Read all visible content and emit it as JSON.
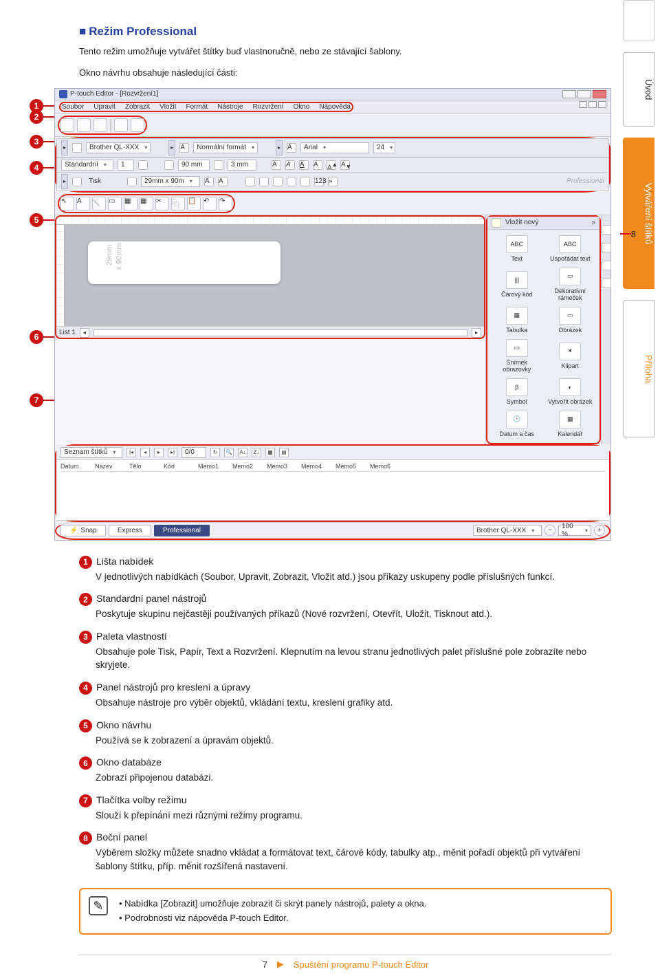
{
  "section": {
    "title": "Režim Professional",
    "lead1": "Tento režim umožňuje vytvářet štítky buď vlastnoručně, nebo ze stávající šablony.",
    "lead2": "Okno návrhu obsahuje následující části:"
  },
  "side_tabs": {
    "uvod": "Úvod",
    "stitky": "Vytváření štítků",
    "priloha": "Příloha"
  },
  "callouts": [
    "1",
    "2",
    "3",
    "4",
    "5",
    "6",
    "7",
    "8"
  ],
  "app": {
    "title": "P-touch Editor - [Rozvržení1]",
    "menu": [
      "Soubor",
      "Upravit",
      "Zobrazit",
      "Vložit",
      "Formát",
      "Nástroje",
      "Rozvržení",
      "Okno",
      "Nápověda"
    ],
    "printer": "Brother QL-XXX",
    "format_dd": "Normální formát",
    "font": "Arial",
    "font_size": "24",
    "std_label": "Standardní",
    "print_count": "1",
    "w": "90 mm",
    "h": "3 mm",
    "tisk": "Tisk",
    "tape": "29mm x 90m",
    "prof_brand": "Professional",
    "side_strip": "Vložit nový",
    "side_more": "»",
    "side_items": [
      [
        "Text",
        "ABC"
      ],
      [
        "Uspořádat text",
        "ABC"
      ],
      [
        "Čárový kód",
        "|||"
      ],
      [
        "Dekorativní rámeček",
        "▭"
      ],
      [
        "Tabulka",
        "▦"
      ],
      [
        "Obrázek",
        "▭"
      ],
      [
        "Snímek obrazovky",
        "▭"
      ],
      [
        "Klipart",
        "✶"
      ],
      [
        "Symbol",
        "β"
      ],
      [
        "Vytvořit obrázek",
        "◐"
      ],
      [
        "Datum a čas",
        "🕒"
      ],
      [
        "Kalendář",
        "▦"
      ]
    ],
    "canvas_dim1": "29mm",
    "canvas_dim2": "x 90mm",
    "list_label": "List 1",
    "db_label": "Seznam štítků",
    "db_nav_count": "0/0",
    "db_cols": [
      "Datum",
      "Název",
      "Tělo",
      "Kód",
      "Memo1",
      "Memo2",
      "Memo3",
      "Memo4",
      "Memo5",
      "Memo6"
    ],
    "mode_snap": "Snap",
    "mode_express": "Express",
    "mode_pro": "Professional",
    "status_printer": "Brother QL-XXX",
    "zoom": "100 %"
  },
  "legend": [
    {
      "n": "1",
      "h": "Lišta nabídek",
      "t": "V jednotlivých nabídkách (Soubor, Upravit, Zobrazit, Vložit atd.) jsou příkazy uskupeny podle příslušných funkcí."
    },
    {
      "n": "2",
      "h": "Standardní panel nástrojů",
      "t": "Poskytuje skupinu nejčastěji používaných příkazů (Nové rozvržení, Otevřít, Uložit, Tisknout atd.)."
    },
    {
      "n": "3",
      "h": "Paleta vlastností",
      "t": "Obsahuje pole Tisk, Papír, Text a Rozvržení. Klepnutím na levou stranu jednotlivých palet příslušné pole zobrazíte nebo skryjete."
    },
    {
      "n": "4",
      "h": "Panel nástrojů pro kreslení a úpravy",
      "t": "Obsahuje nástroje pro výběr objektů, vkládání textu, kreslení grafiky atd."
    },
    {
      "n": "5",
      "h": "Okno návrhu",
      "t": "Používá se k zobrazení a úpravám objektů."
    },
    {
      "n": "6",
      "h": "Okno databáze",
      "t": "Zobrazí připojenou databázi."
    },
    {
      "n": "7",
      "h": "Tlačítka volby režimu",
      "t": "Slouží k přepínání mezi různými režimy programu."
    },
    {
      "n": "8",
      "h": "Boční panel",
      "t": "Výběrem složky můžete snadno vkládat a formátovat text, čárové kódy, tabulky atp., měnit pořadí objektů při vytváření šablony štítku, příp. měnit rozšířená nastavení."
    }
  ],
  "note": {
    "l1": "Nabídka [Zobrazit] umožňuje zobrazit či skrýt panely nástrojů, palety a okna.",
    "l2": "Podrobnosti viz nápověda P-touch Editor."
  },
  "footer": {
    "page": "7",
    "crumb": "Spuštění programu P-touch Editor"
  }
}
